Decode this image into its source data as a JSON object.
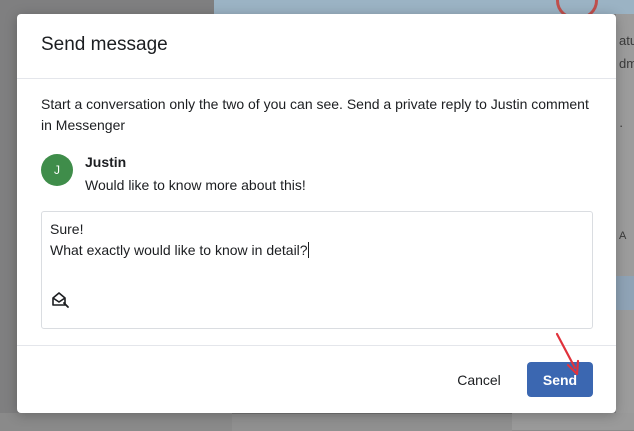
{
  "background": {
    "right_labels": [
      "atu",
      "dm",
      "·",
      "A",
      ""
    ]
  },
  "dialog": {
    "title": "Send message",
    "description": "Start a conversation only the two of you can see. Send a private reply to Justin comment in Messenger",
    "comment": {
      "author_initial": "J",
      "author_name": "Justin",
      "text": "Would like to know more about this!"
    },
    "reply": {
      "lines": [
        "Sure!",
        "What exactly would like to know in detail?"
      ]
    },
    "icons": {
      "saved_reply": "saved-reply-icon"
    },
    "buttons": {
      "cancel": "Cancel",
      "send": "Send"
    }
  },
  "colors": {
    "send_button": "#3b67b1",
    "avatar": "#3f8d4a",
    "annotation_arrow": "#e0323c"
  }
}
